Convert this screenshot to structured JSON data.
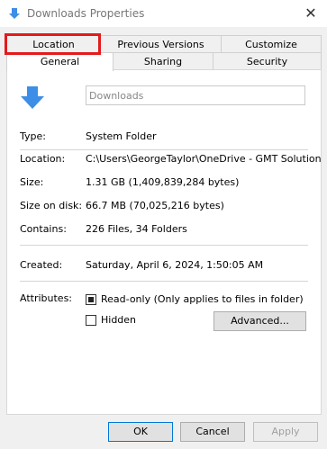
{
  "window": {
    "title": "Downloads Properties"
  },
  "tabs": {
    "row1": [
      "Location",
      "Previous Versions",
      "Customize"
    ],
    "row2": [
      "General",
      "Sharing",
      "Security"
    ]
  },
  "general": {
    "folder_name_placeholder": "Downloads",
    "type_label": "Type:",
    "type_value": "System Folder",
    "location_label": "Location:",
    "location_value": "C:\\Users\\GeorgeTaylor\\OneDrive - GMT Solutions L",
    "size_label": "Size:",
    "size_value": "1.31 GB (1,409,839,284 bytes)",
    "size_on_disk_label": "Size on disk:",
    "size_on_disk_value": "66.7 MB (70,025,216 bytes)",
    "contains_label": "Contains:",
    "contains_value": "226 Files, 34 Folders",
    "created_label": "Created:",
    "created_value": "Saturday, April 6, 2024, 1:50:05 AM",
    "attributes_label": "Attributes:",
    "readonly_label": "Read-only (Only applies to files in folder)",
    "hidden_label": "Hidden",
    "advanced_button": "Advanced..."
  },
  "footer": {
    "ok": "OK",
    "cancel": "Cancel",
    "apply": "Apply"
  },
  "colors": {
    "accent": "#0078d7",
    "highlight": "#e41a1c",
    "folder_arrow": "#3d8ee6"
  }
}
